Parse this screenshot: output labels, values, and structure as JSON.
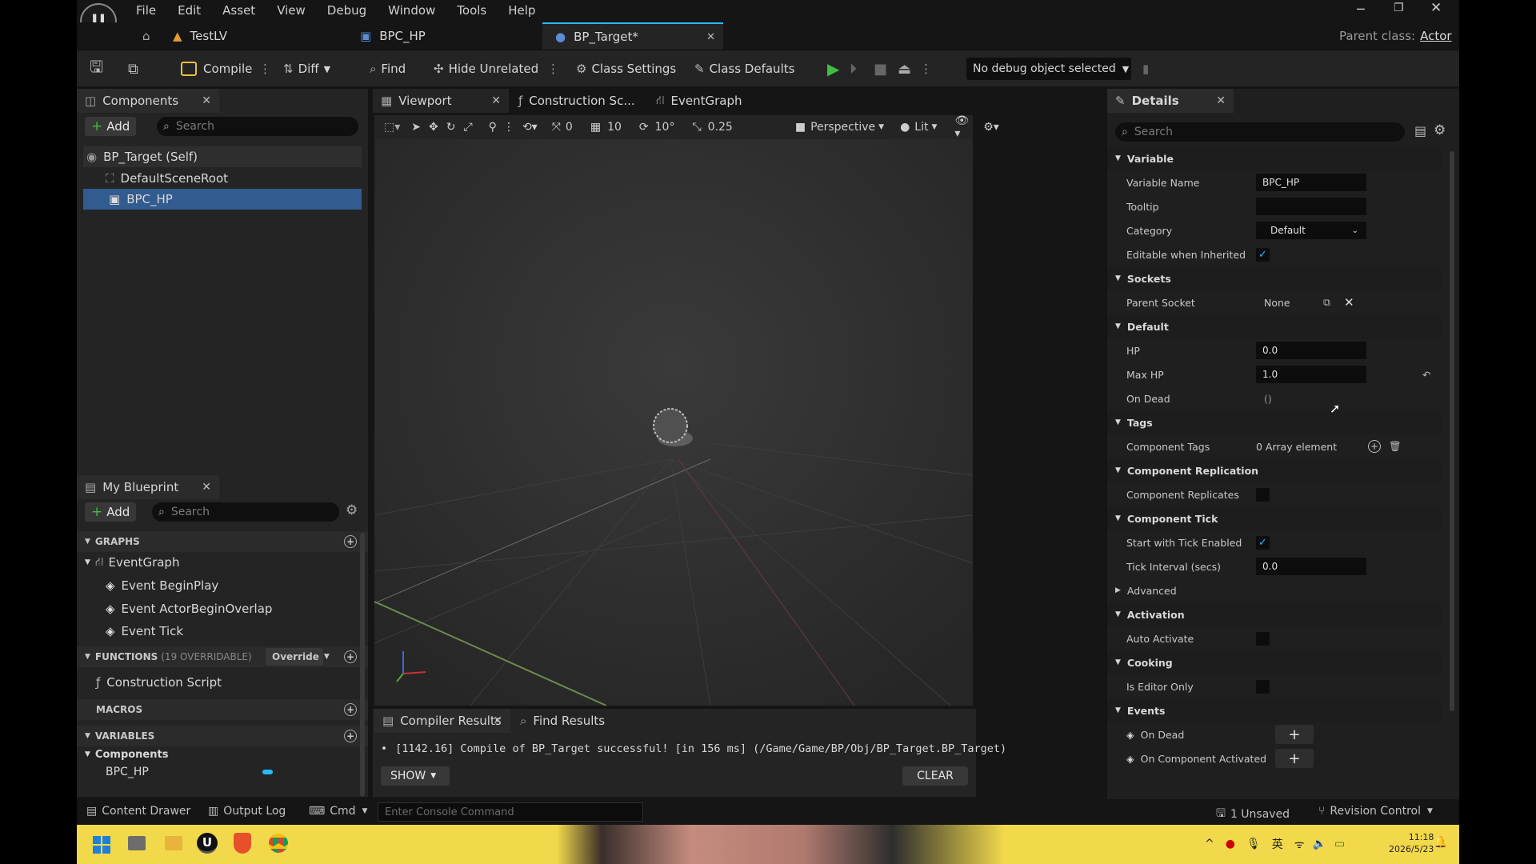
{
  "menu": [
    "File",
    "Edit",
    "Asset",
    "View",
    "Debug",
    "Window",
    "Tools",
    "Help"
  ],
  "doc_tabs": {
    "level": "TestLV",
    "component": "BPC_HP",
    "blueprint": "BP_Target*"
  },
  "parent_class": {
    "label": "Parent class:",
    "value": "Actor"
  },
  "toolbar": {
    "compile": "Compile",
    "diff": "Diff",
    "find": "Find",
    "hide_unrelated": "Hide Unrelated",
    "class_settings": "Class Settings",
    "class_defaults": "Class Defaults",
    "debug_object": "No debug object selected"
  },
  "components": {
    "tab": "Components",
    "add": "Add",
    "search_placeholder": "Search",
    "items": [
      {
        "label": "BP_Target (Self)"
      },
      {
        "label": "DefaultSceneRoot"
      },
      {
        "label": "BPC_HP"
      }
    ]
  },
  "my_blueprint": {
    "tab": "My Blueprint",
    "add": "Add",
    "search_placeholder": "Search",
    "graphs_label": "GRAPHS",
    "event_graph": "EventGraph",
    "events": [
      "Event BeginPlay",
      "Event ActorBeginOverlap",
      "Event Tick"
    ],
    "functions_label": "FUNCTIONS",
    "functions_count": "(19 OVERRIDABLE)",
    "override": "Override",
    "construction_script": "Construction Script",
    "macros_label": "MACROS",
    "variables_label": "VARIABLES",
    "components_label": "Components",
    "var_item": "BPC_HP"
  },
  "editor_tabs": {
    "viewport": "Viewport",
    "construction": "Construction Sc...",
    "event_graph": "EventGraph"
  },
  "viewport_toolbar": {
    "rot_snap_value": "0",
    "grid_snap": "10",
    "angle_snap": "10°",
    "scale_snap": "0.25",
    "perspective": "Perspective",
    "lit": "Lit"
  },
  "compiler": {
    "tab_results": "Compiler Results",
    "tab_find": "Find Results",
    "message": "[1142.16] Compile of BP_Target successful! [in 156 ms] (/Game/Game/BP/Obj/BP_Target.BP_Target)",
    "show": "SHOW",
    "clear": "CLEAR"
  },
  "details": {
    "tab": "Details",
    "search_placeholder": "Search",
    "sec_variable": "Variable",
    "variable_name_label": "Variable Name",
    "variable_name": "BPC_HP",
    "tooltip_label": "Tooltip",
    "tooltip": "",
    "category_label": "Category",
    "category": "Default",
    "editable_label": "Editable when Inherited",
    "sec_sockets": "Sockets",
    "parent_socket_label": "Parent Socket",
    "parent_socket": "None",
    "sec_default": "Default",
    "hp_label": "HP",
    "hp": "0.0",
    "max_hp_label": "Max HP",
    "max_hp": "1.0",
    "on_dead_label": "On Dead",
    "on_dead": "()",
    "sec_tags": "Tags",
    "component_tags_label": "Component Tags",
    "component_tags": "0 Array element",
    "sec_replication": "Component Replication",
    "replicates_label": "Component Replicates",
    "sec_tick": "Component Tick",
    "start_tick_label": "Start with Tick Enabled",
    "tick_interval_label": "Tick Interval (secs)",
    "tick_interval": "0.0",
    "advanced": "Advanced",
    "sec_activation": "Activation",
    "auto_activate_label": "Auto Activate",
    "sec_cooking": "Cooking",
    "editor_only_label": "Is Editor Only",
    "sec_events": "Events",
    "event_on_dead": "On Dead",
    "event_on_activated": "On Component Activated"
  },
  "statusbar": {
    "content_drawer": "Content Drawer",
    "output_log": "Output Log",
    "cmd": "Cmd",
    "console_placeholder": "Enter Console Command",
    "unsaved": "1 Unsaved",
    "revision": "Revision Control"
  },
  "taskbar": {
    "time": "11:18",
    "date": "2026/5/23",
    "ime": "英"
  },
  "colors": {
    "accent_blue": "#26bbff",
    "play_green": "#3fbf3f",
    "selected_row": "#325b8f",
    "taskbar_yellow": "#f2d94b"
  }
}
